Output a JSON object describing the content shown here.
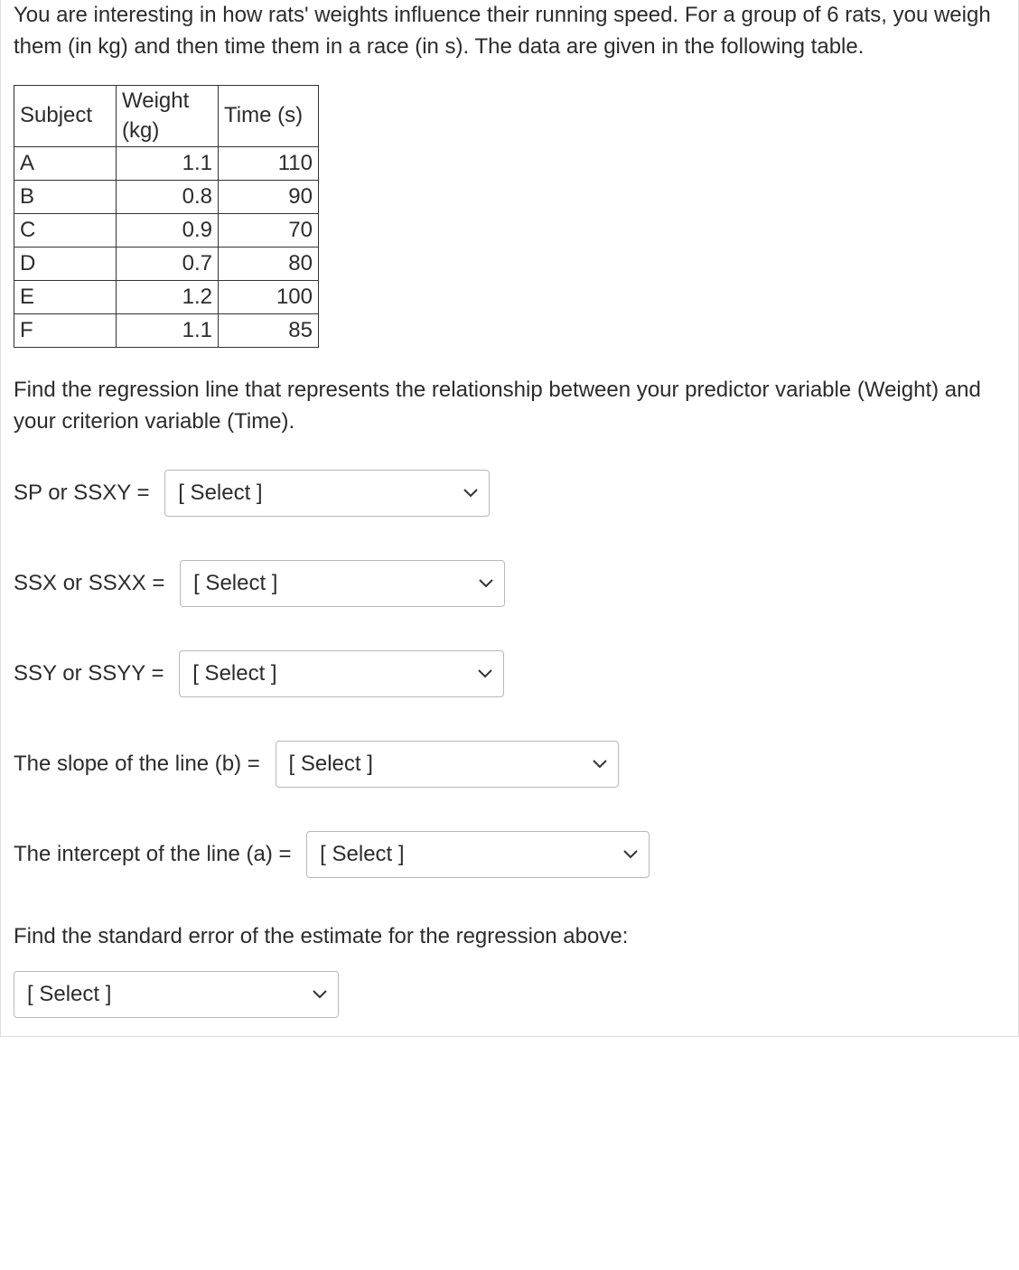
{
  "intro": "You are interesting in how rats' weights influence their running speed. For a group of 6 rats, you weigh them (in kg) and then time them in a race (in s). The data are given in the following table.",
  "table": {
    "headers": {
      "subject": "Subject",
      "weight": "Weight (kg)",
      "time": "Time (s)"
    },
    "rows": [
      {
        "subject": "A",
        "weight": "1.1",
        "time": "110"
      },
      {
        "subject": "B",
        "weight": "0.8",
        "time": "90"
      },
      {
        "subject": "C",
        "weight": "0.9",
        "time": "70"
      },
      {
        "subject": "D",
        "weight": "0.7",
        "time": "80"
      },
      {
        "subject": "E",
        "weight": "1.2",
        "time": "100"
      },
      {
        "subject": "F",
        "weight": "1.1",
        "time": "85"
      }
    ]
  },
  "find_text": "Find the regression line that represents the relationship between your predictor variable (Weight) and your criterion variable (Time).",
  "questions": {
    "sp": {
      "label": "SP or SSXY = ",
      "placeholder": "[ Select ]"
    },
    "ssx": {
      "label": "SSX or SSXX = ",
      "placeholder": "[ Select ]"
    },
    "ssy": {
      "label": "SSY or SSYY = ",
      "placeholder": "[ Select ]"
    },
    "slope": {
      "label": "The slope of the line (b) = ",
      "placeholder": "[ Select ]"
    },
    "intercept": {
      "label": "The intercept of the line (a) = ",
      "placeholder": "[ Select ]"
    }
  },
  "std_err_prompt": "Find the standard error of the estimate for the regression above:",
  "std_err_select": {
    "placeholder": "[ Select ]"
  }
}
